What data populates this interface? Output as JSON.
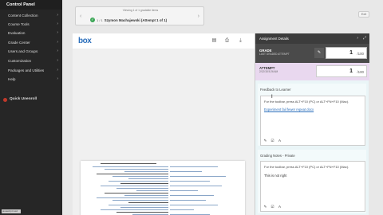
{
  "sidebar": {
    "title": "Control Panel",
    "items": [
      {
        "label": "Content Collection"
      },
      {
        "label": "Course Tools"
      },
      {
        "label": "Evaluation"
      },
      {
        "label": "Grade Center"
      },
      {
        "label": "Users and Groups"
      },
      {
        "label": "Customization"
      },
      {
        "label": "Packages and Utilities"
      },
      {
        "label": "Help"
      }
    ],
    "quick_unenroll": "Quick Unenroll",
    "status_url": "javascript:void"
  },
  "banner": {
    "viewing": "Viewing 1 of 1 gradable items",
    "count": "1 / 1",
    "student": "Szymon Machajewski (Attempt 1 of 1)",
    "exit": "Exit"
  },
  "viewer": {
    "logo": "box",
    "icons": [
      "comment-icon",
      "print-icon",
      "download-icon"
    ]
  },
  "details": {
    "header": "Assignment Details",
    "grade_label": "GRADE",
    "grade_sub": "LAST GRADED ATTEMPT",
    "grade_value": "1",
    "grade_out_of": "/100",
    "attempt_label": "ATTEMPT",
    "attempt_date": "2/12/18 5:26 AM",
    "attempt_value": "1",
    "attempt_out_of": "/100",
    "feedback_label": "Feedback to Learner",
    "feedback_hint": "For the toolbar, press ALT+F10 (PC) or ALT+FN+F10 (Mac).",
    "feedback_link": "Experiment fail fewer repeat docx",
    "grading_label": "Grading Notes - Private",
    "grading_hint": "For the toolbar, press ALT+F10 (PC) or ALT+FN+F10 (Mac).",
    "grading_text": "This is not right"
  },
  "colors": {
    "sidebar": "#262626",
    "accent": "#2a6ebb",
    "attempt_bg": "#e9d8ef",
    "panel_bg": "#eaf5f7"
  }
}
